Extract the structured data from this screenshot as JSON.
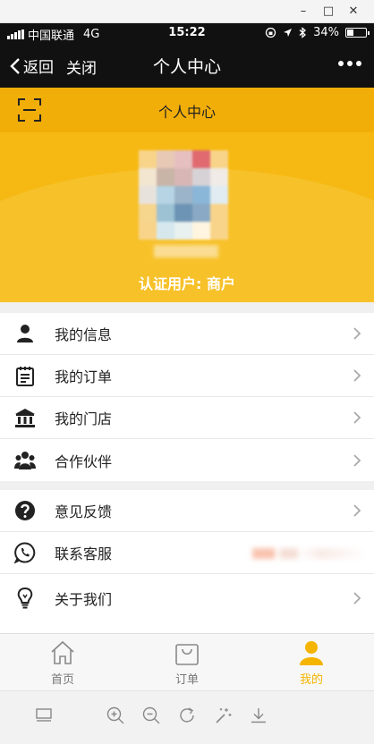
{
  "window": {
    "minimize": "–",
    "maximize": "□",
    "close": "✕"
  },
  "status_bar": {
    "carrier": "中国联通",
    "network": "4G",
    "time": "15:22",
    "battery": "34%"
  },
  "nav": {
    "back_label": "返回",
    "close_label": "关闭",
    "title": "个人中心"
  },
  "header": {
    "title": "个人中心",
    "certification": "认证用户: 商户"
  },
  "menu_group_1": [
    {
      "label": "我的信息",
      "icon": "person-icon"
    },
    {
      "label": "我的订单",
      "icon": "clipboard-icon"
    },
    {
      "label": "我的门店",
      "icon": "bank-icon"
    },
    {
      "label": "合作伙伴",
      "icon": "group-icon"
    }
  ],
  "menu_group_2": [
    {
      "label": "意见反馈",
      "icon": "question-icon"
    },
    {
      "label": "联系客服",
      "icon": "phone-chat-icon"
    },
    {
      "label": "关于我们",
      "icon": "lightbulb-icon"
    }
  ],
  "tab_bar": [
    {
      "label": "首页",
      "icon": "home-icon",
      "active": false
    },
    {
      "label": "订单",
      "icon": "bag-icon",
      "active": false
    },
    {
      "label": "我的",
      "icon": "user-icon",
      "active": true
    }
  ],
  "colors": {
    "accent": "#f5b400",
    "header": "#f6b913",
    "nav": "#111111"
  }
}
